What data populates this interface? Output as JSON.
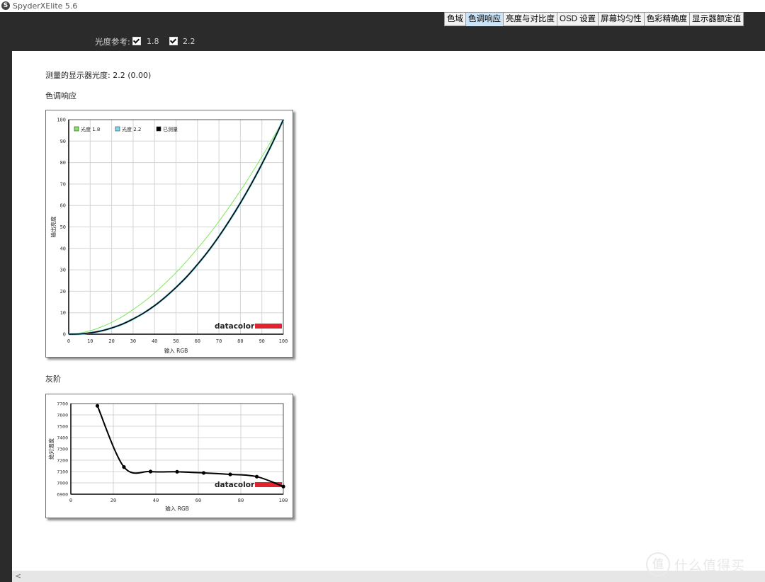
{
  "window": {
    "app_icon": "S",
    "title": "SpyderXElite 5.6"
  },
  "tabs": [
    {
      "label": "色域",
      "active": false
    },
    {
      "label": "色调响应",
      "active": true
    },
    {
      "label": "亮度与对比度",
      "active": false
    },
    {
      "label": "OSD 设置",
      "active": false
    },
    {
      "label": "屏幕均匀性",
      "active": false
    },
    {
      "label": "色彩精确度",
      "active": false
    },
    {
      "label": "显示器额定值",
      "active": false
    }
  ],
  "toolbar": {
    "gamma_reference_label": "光度参考:",
    "checkbox_1_8": {
      "label": "1.8",
      "checked": true
    },
    "checkbox_2_2": {
      "label": "2.2",
      "checked": true
    }
  },
  "content": {
    "measured_gamma": "测量的显示器光度:  2.2 (0.00)",
    "tone_response_title": "色调响应",
    "grayscale_title": "灰阶"
  },
  "logo_text": "datacolor",
  "watermark": {
    "icon": "值",
    "text": "什么值得买"
  },
  "colors": {
    "gamma18": "#7ee85a",
    "gamma22": "#7fd9ec",
    "measured": "#000000",
    "brand_red": "#e0232e",
    "active_tab": "#cce4f7"
  },
  "chart_data": [
    {
      "type": "line",
      "xlabel": "输入 RGB",
      "ylabel": "输出亮度",
      "xlim": [
        0,
        100
      ],
      "ylim": [
        0,
        100
      ],
      "grid": true,
      "legend_position": "top-left",
      "x_ticks": [
        "0",
        "10",
        "20",
        "30",
        "40",
        "50",
        "60",
        "70",
        "80",
        "90",
        "100"
      ],
      "y_ticks": [
        "0",
        "10",
        "20",
        "30",
        "40",
        "50",
        "60",
        "70",
        "80",
        "90",
        "100"
      ],
      "series": [
        {
          "name": "光度 1.8",
          "color": "#7ee85a",
          "gamma": 1.8,
          "x": [
            0,
            5,
            10,
            15,
            20,
            25,
            30,
            35,
            40,
            45,
            50,
            55,
            60,
            65,
            70,
            75,
            80,
            85,
            90,
            95,
            100
          ],
          "y": [
            0,
            0.5,
            1.6,
            3.3,
            5.5,
            8.2,
            11.5,
            15.1,
            19.2,
            23.8,
            28.7,
            34.1,
            39.9,
            46.0,
            52.6,
            59.6,
            66.9,
            74.6,
            82.7,
            91.2,
            100
          ]
        },
        {
          "name": "光度 2.2",
          "color": "#7fd9ec",
          "gamma": 2.2,
          "x": [
            0,
            5,
            10,
            15,
            20,
            25,
            30,
            35,
            40,
            45,
            50,
            55,
            60,
            65,
            70,
            75,
            80,
            85,
            90,
            95,
            100
          ],
          "y": [
            0,
            0.1,
            0.6,
            1.5,
            2.9,
            4.7,
            7.1,
            9.9,
            13.3,
            17.3,
            21.8,
            26.8,
            32.5,
            38.7,
            45.6,
            53.1,
            61.2,
            69.9,
            79.3,
            89.3,
            100
          ]
        },
        {
          "name": "已测量",
          "color": "#000000",
          "x": [
            0,
            5,
            10,
            15,
            20,
            25,
            30,
            35,
            40,
            45,
            50,
            55,
            60,
            65,
            70,
            75,
            80,
            85,
            90,
            95,
            100
          ],
          "y": [
            0,
            0.1,
            0.6,
            1.5,
            2.9,
            4.7,
            7.1,
            9.9,
            13.3,
            17.3,
            21.8,
            26.8,
            32.5,
            38.7,
            45.6,
            53.1,
            61.2,
            69.9,
            79.3,
            89.3,
            100
          ]
        }
      ]
    },
    {
      "type": "line",
      "xlabel": "输入 RGB",
      "ylabel": "绝对温度",
      "xlim": [
        0,
        100
      ],
      "ylim": [
        6900,
        7700
      ],
      "grid": true,
      "x_ticks": [
        "0",
        "20",
        "40",
        "60",
        "80",
        "100"
      ],
      "y_ticks": [
        "6900",
        "7000",
        "7100",
        "7200",
        "7300",
        "7400",
        "7500",
        "7600",
        "7700"
      ],
      "series": [
        {
          "name": "",
          "x": [
            12.5,
            25,
            37.5,
            50,
            62.5,
            75,
            87.5,
            100
          ],
          "y": [
            7680,
            7140,
            7100,
            7098,
            7088,
            7075,
            7055,
            6968
          ]
        }
      ]
    }
  ]
}
